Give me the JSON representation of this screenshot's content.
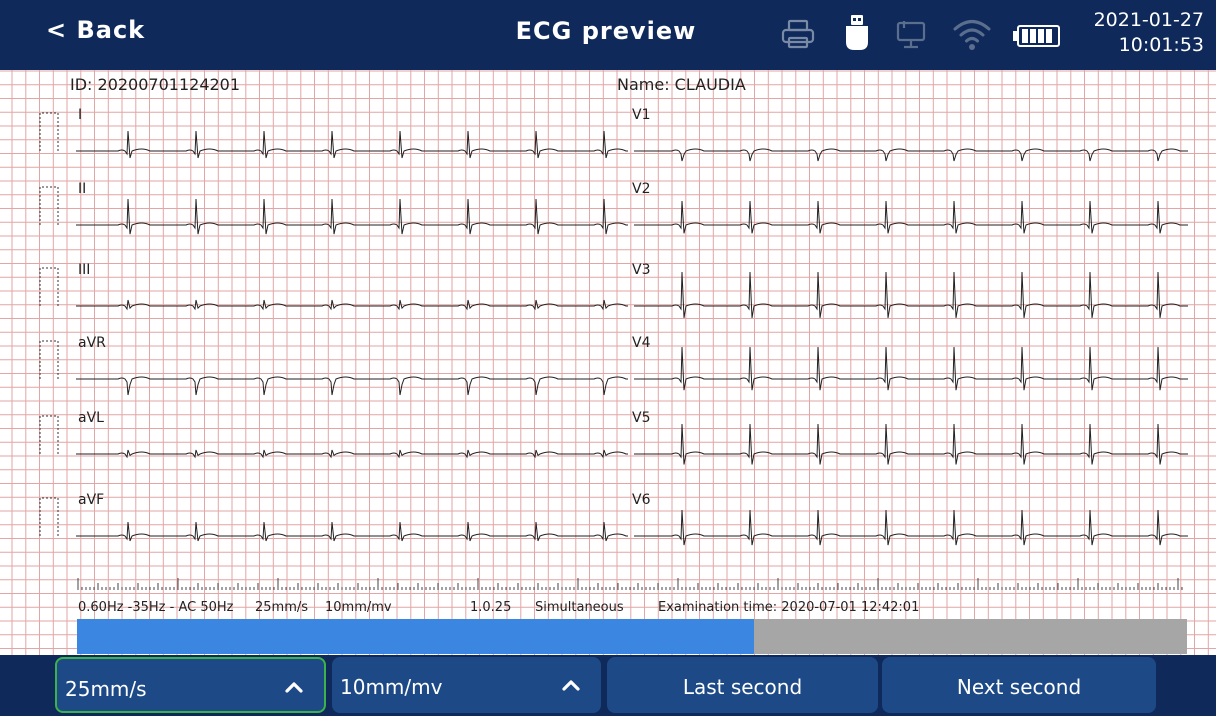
{
  "header": {
    "back_label": "< Back",
    "title": "ECG preview",
    "date": "2021-01-27",
    "time": "10:01:53",
    "icons": [
      "printer-icon",
      "usb-drive-icon",
      "network-icon",
      "wifi-icon",
      "battery-icon"
    ]
  },
  "patient": {
    "id_text": "ID: 20200701124201",
    "name_text": "Name: CLAUDIA"
  },
  "leads": {
    "left": [
      "I",
      "II",
      "III",
      "aVR",
      "aVL",
      "aVF"
    ],
    "right": [
      "V1",
      "V2",
      "V3",
      "V4",
      "V5",
      "V6"
    ]
  },
  "ecg_info": {
    "filter": "0.60Hz -35Hz - AC 50Hz",
    "speed": "25mm/s",
    "gain": "10mm/mv",
    "version": "1.0.25",
    "mode": "Simultaneous",
    "exam_time": "Examination time: 2020-07-01 12:42:01"
  },
  "progress": {
    "fraction": 0.61
  },
  "footer": {
    "speed_value": "25mm/s",
    "gain_value": "10mm/mv",
    "last_second_label": "Last second",
    "next_second_label": "Next second"
  },
  "colors": {
    "header_bg": "#0f2a5a",
    "button_bg": "#1d4a86",
    "active_border": "#3cb24a",
    "grid_line": "#e2a6a6",
    "progress_fill": "#3b86e0",
    "progress_track": "#a6a6a6",
    "trace": "#222222"
  }
}
